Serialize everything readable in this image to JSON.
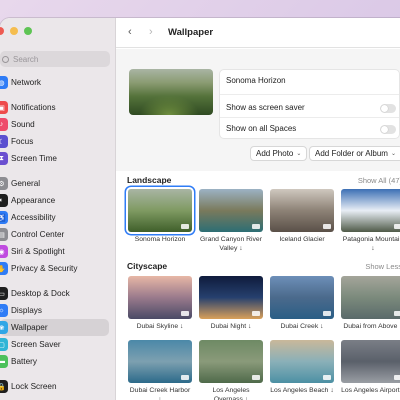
{
  "sidebar": {
    "search_placeholder": "Search",
    "items": [
      {
        "label": "Network",
        "icon": "globe-icon",
        "color": "#2f7cf6",
        "glyph": "◍"
      },
      {
        "label": "Notifications",
        "icon": "bell-icon",
        "color": "#ee4b4b",
        "glyph": "▣"
      },
      {
        "label": "Sound",
        "icon": "speaker-icon",
        "color": "#ee4b6b",
        "glyph": "♪"
      },
      {
        "label": "Focus",
        "icon": "moon-icon",
        "color": "#5a4fd0",
        "glyph": "☾"
      },
      {
        "label": "Screen Time",
        "icon": "hourglass-icon",
        "color": "#6a4fd0",
        "glyph": "⧗"
      },
      {
        "label": "General",
        "icon": "gear-icon",
        "color": "#8d8d92",
        "glyph": "⚙"
      },
      {
        "label": "Appearance",
        "icon": "appearance-icon",
        "color": "#1f1f1f",
        "glyph": "◐"
      },
      {
        "label": "Accessibility",
        "icon": "accessibility-icon",
        "color": "#2f7cf6",
        "glyph": "♿"
      },
      {
        "label": "Control Center",
        "icon": "control-center-icon",
        "color": "#8d8d92",
        "glyph": "▤"
      },
      {
        "label": "Siri & Spotlight",
        "icon": "siri-icon",
        "color": "#c04be0",
        "glyph": "◉"
      },
      {
        "label": "Privacy & Security",
        "icon": "hand-icon",
        "color": "#2f7cf6",
        "glyph": "✋"
      },
      {
        "label": "Desktop & Dock",
        "icon": "dock-icon",
        "color": "#1f1f1f",
        "glyph": "▭"
      },
      {
        "label": "Displays",
        "icon": "display-icon",
        "color": "#2f7cf6",
        "glyph": "☼"
      },
      {
        "label": "Wallpaper",
        "icon": "wallpaper-icon",
        "color": "#2fa6e6",
        "glyph": "❀"
      },
      {
        "label": "Screen Saver",
        "icon": "screensaver-icon",
        "color": "#2fb5d6",
        "glyph": "▢"
      },
      {
        "label": "Battery",
        "icon": "battery-icon",
        "color": "#4cc15b",
        "glyph": "▬"
      },
      {
        "label": "Lock Screen",
        "icon": "lock-icon",
        "color": "#1f1f1f",
        "glyph": "🔒"
      }
    ],
    "active": "Wallpaper"
  },
  "header": {
    "title": "Wallpaper",
    "back": "‹",
    "forward": "›"
  },
  "current": {
    "name": "Sonoma Horizon",
    "screen_saver_label": "Show as screen saver",
    "all_spaces_label": "Show on all Spaces",
    "add_photo": "Add Photo",
    "add_folder": "Add Folder or Album"
  },
  "landscape": {
    "title": "Landscape",
    "link": "Show All (47)",
    "tiles": [
      {
        "caption": "Sonoma Horizon",
        "colors": [
          "#a9b5a4",
          "#7f9a62",
          "#3f5f2a"
        ],
        "selected": true
      },
      {
        "caption": "Grand Canyon River Valley ↓",
        "colors": [
          "#9cb2c4",
          "#7a7a5c",
          "#2c6e74"
        ]
      },
      {
        "caption": "Iceland Glacier",
        "colors": [
          "#cfc8bf",
          "#8d8276",
          "#5a5048"
        ]
      },
      {
        "caption": "Patagonia Mountain ↓",
        "colors": [
          "#3c6fb5",
          "#e8eef5",
          "#4f5a48"
        ]
      }
    ]
  },
  "cityscape": {
    "title": "Cityscape",
    "link": "Show Less",
    "row1": [
      {
        "caption": "Dubai Skyline ↓",
        "colors": [
          "#e7b7a6",
          "#9a7a8c",
          "#4a4a66"
        ]
      },
      {
        "caption": "Dubai Night ↓",
        "colors": [
          "#0f1b3c",
          "#26406e",
          "#d9a05a"
        ]
      },
      {
        "caption": "Dubai Creek ↓",
        "colors": [
          "#6d8fb8",
          "#4b6a8c",
          "#2a5e86"
        ]
      },
      {
        "caption": "Dubai from Above ↓",
        "colors": [
          "#a4a59a",
          "#7b8a7c",
          "#5a6a6a"
        ]
      }
    ],
    "row2": [
      {
        "caption": "Dubai Creek Harbor ↓",
        "colors": [
          "#4b88a8",
          "#7da0b0",
          "#2c6a8a"
        ]
      },
      {
        "caption": "Los Angeles Overpass ↓",
        "colors": [
          "#6e8a64",
          "#8a9a7a",
          "#4f6a4a"
        ]
      },
      {
        "caption": "Los Angeles Beach ↓",
        "colors": [
          "#c9b89a",
          "#8ab0b8",
          "#4c90a4"
        ]
      },
      {
        "caption": "Los Angeles Airport ↓",
        "colors": [
          "#7a7e86",
          "#5a606a",
          "#9a9ea4"
        ]
      }
    ]
  }
}
